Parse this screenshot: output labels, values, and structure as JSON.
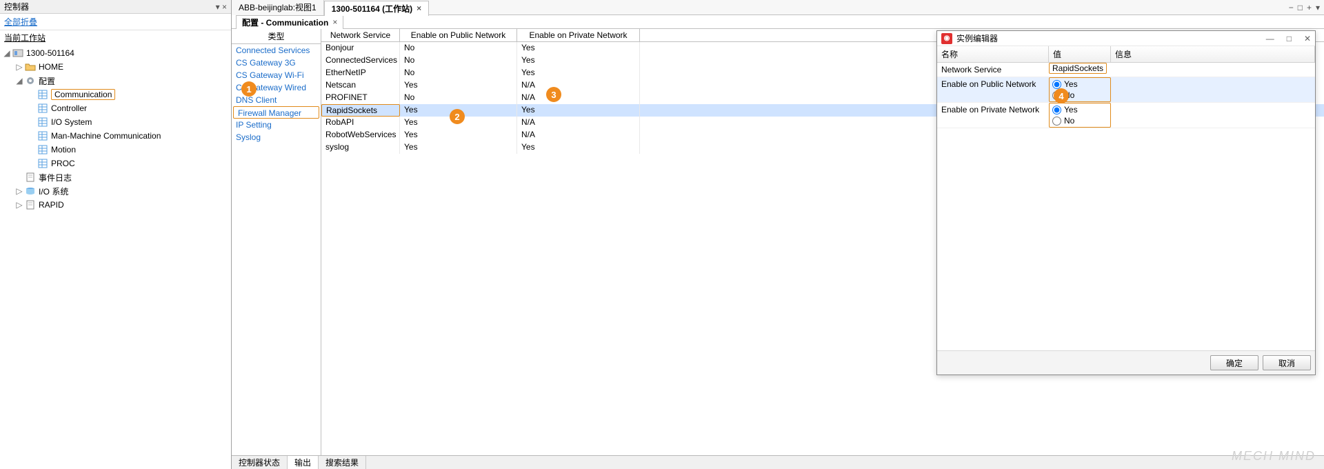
{
  "sidebar": {
    "title": "控制器",
    "collapse_all": "全部折叠",
    "section": "当前工作站",
    "tree": [
      {
        "level": 0,
        "expander": "open",
        "icon": "controller",
        "label": "1300-501164"
      },
      {
        "level": 1,
        "expander": "closed",
        "icon": "folder",
        "label": "HOME"
      },
      {
        "level": 1,
        "expander": "open",
        "icon": "gear",
        "label": "配置"
      },
      {
        "level": 2,
        "expander": "none",
        "icon": "grid",
        "label": "Communication",
        "selected": true
      },
      {
        "level": 2,
        "expander": "none",
        "icon": "grid",
        "label": "Controller"
      },
      {
        "level": 2,
        "expander": "none",
        "icon": "grid",
        "label": "I/O System"
      },
      {
        "level": 2,
        "expander": "none",
        "icon": "grid",
        "label": "Man-Machine Communication"
      },
      {
        "level": 2,
        "expander": "none",
        "icon": "grid",
        "label": "Motion"
      },
      {
        "level": 2,
        "expander": "none",
        "icon": "grid",
        "label": "PROC"
      },
      {
        "level": 1,
        "expander": "none",
        "icon": "page",
        "label": "事件日志"
      },
      {
        "level": 1,
        "expander": "closed",
        "icon": "disk",
        "label": "I/O 系统"
      },
      {
        "level": 1,
        "expander": "closed",
        "icon": "page",
        "label": "RAPID"
      }
    ]
  },
  "tabs": {
    "items": [
      {
        "label": "ABB-beijinglab:视图1",
        "active": false
      },
      {
        "label": "1300-501164 (工作站)",
        "active": true
      }
    ],
    "right_icons": [
      "−",
      "□",
      "+",
      "▾"
    ]
  },
  "subtab": {
    "label": "配置 - Communication"
  },
  "types": {
    "header": "类型",
    "items": [
      "Connected Services",
      "CS Gateway 3G",
      "CS Gateway Wi-Fi",
      "CS Gateway Wired",
      "DNS Client",
      "Firewall Manager",
      "IP Setting",
      "Syslog"
    ],
    "selected_index": 5
  },
  "services": {
    "headers": [
      "Network Service",
      "Enable on Public Network",
      "Enable on Private Network"
    ],
    "rows": [
      {
        "c1": "Bonjour",
        "c2": "No",
        "c3": "Yes"
      },
      {
        "c1": "ConnectedServices",
        "c2": "No",
        "c3": "Yes"
      },
      {
        "c1": "EtherNetIP",
        "c2": "No",
        "c3": "Yes"
      },
      {
        "c1": "Netscan",
        "c2": "Yes",
        "c3": "N/A"
      },
      {
        "c1": "PROFINET",
        "c2": "No",
        "c3": "N/A"
      },
      {
        "c1": "RapidSockets",
        "c2": "Yes",
        "c3": "Yes",
        "selected": true
      },
      {
        "c1": "RobAPI",
        "c2": "Yes",
        "c3": "N/A"
      },
      {
        "c1": "RobotWebServices",
        "c2": "Yes",
        "c3": "N/A"
      },
      {
        "c1": "syslog",
        "c2": "Yes",
        "c3": "Yes"
      }
    ]
  },
  "editor": {
    "title": "实例编辑器",
    "window_buttons": [
      "—",
      "□",
      "✕"
    ],
    "headers": [
      "名称",
      "值",
      "信息"
    ],
    "rows": [
      {
        "name": "Network Service",
        "value": "RapidSockets",
        "type": "text"
      },
      {
        "name": "Enable on Public Network",
        "value": "Yes",
        "type": "radio",
        "options": [
          "Yes",
          "No"
        ],
        "selected": true
      },
      {
        "name": "Enable on Private Network",
        "value": "Yes",
        "type": "radio",
        "options": [
          "Yes",
          "No"
        ]
      }
    ],
    "ok": "确定",
    "cancel": "取消"
  },
  "bottom_tabs": [
    "控制器状态",
    "输出",
    "搜索结果"
  ],
  "bottom_active": 1,
  "annotations": {
    "b1": "1",
    "b2": "2",
    "b3": "3",
    "b4": "4"
  },
  "watermark": "MECH MIND"
}
